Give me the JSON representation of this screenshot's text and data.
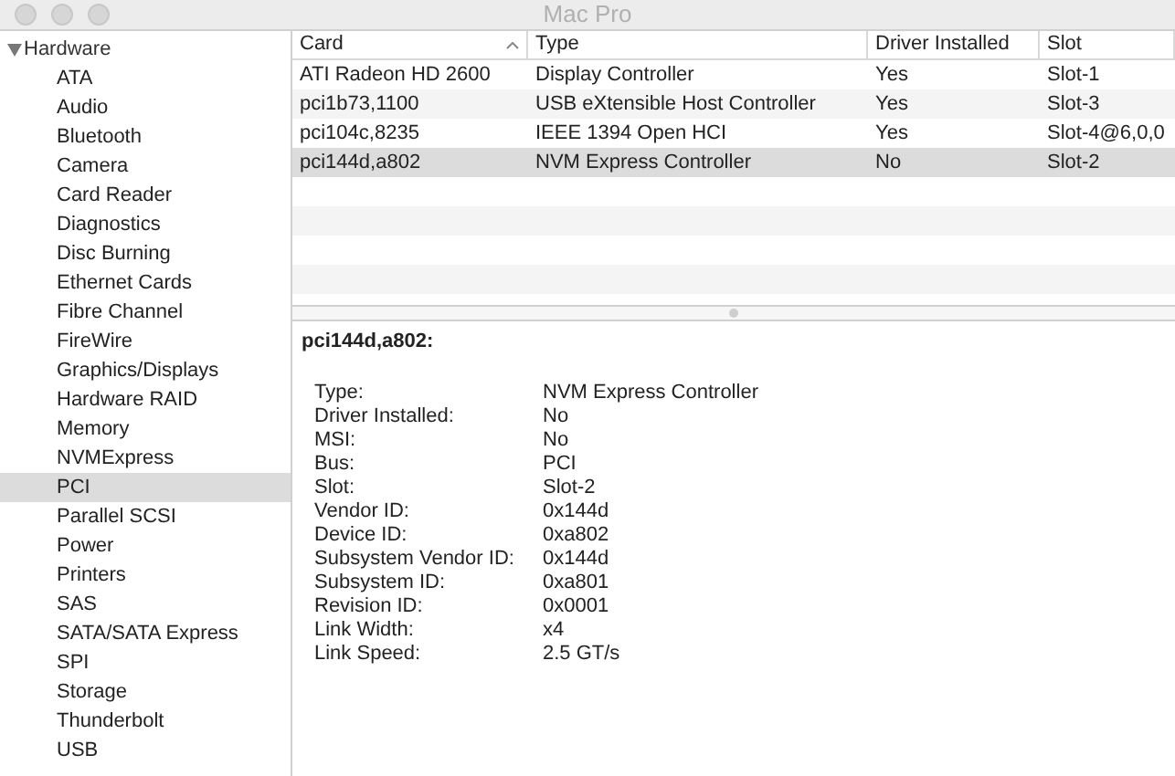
{
  "window": {
    "title": "Mac Pro"
  },
  "sidebar": {
    "group": {
      "label": "Hardware",
      "expanded": true,
      "children": [
        {
          "label": "ATA",
          "selected": false
        },
        {
          "label": "Audio",
          "selected": false
        },
        {
          "label": "Bluetooth",
          "selected": false
        },
        {
          "label": "Camera",
          "selected": false
        },
        {
          "label": "Card Reader",
          "selected": false
        },
        {
          "label": "Diagnostics",
          "selected": false
        },
        {
          "label": "Disc Burning",
          "selected": false
        },
        {
          "label": "Ethernet Cards",
          "selected": false
        },
        {
          "label": "Fibre Channel",
          "selected": false
        },
        {
          "label": "FireWire",
          "selected": false
        },
        {
          "label": "Graphics/Displays",
          "selected": false
        },
        {
          "label": "Hardware RAID",
          "selected": false
        },
        {
          "label": "Memory",
          "selected": false
        },
        {
          "label": "NVMExpress",
          "selected": false
        },
        {
          "label": "PCI",
          "selected": true
        },
        {
          "label": "Parallel SCSI",
          "selected": false
        },
        {
          "label": "Power",
          "selected": false
        },
        {
          "label": "Printers",
          "selected": false
        },
        {
          "label": "SAS",
          "selected": false
        },
        {
          "label": "SATA/SATA Express",
          "selected": false
        },
        {
          "label": "SPI",
          "selected": false
        },
        {
          "label": "Storage",
          "selected": false
        },
        {
          "label": "Thunderbolt",
          "selected": false
        },
        {
          "label": "USB",
          "selected": false
        }
      ]
    }
  },
  "table": {
    "columns": [
      {
        "label": "Card",
        "sorted": true
      },
      {
        "label": "Type",
        "sorted": false
      },
      {
        "label": "Driver Installed",
        "sorted": false
      },
      {
        "label": "Slot",
        "sorted": false
      }
    ],
    "rows": [
      {
        "cells": [
          "ATI Radeon HD 2600",
          "Display Controller",
          "Yes",
          "Slot-1"
        ],
        "selected": false
      },
      {
        "cells": [
          "pci1b73,1100",
          "USB eXtensible Host Controller",
          "Yes",
          "Slot-3"
        ],
        "selected": false
      },
      {
        "cells": [
          "pci104c,8235",
          "IEEE 1394 Open HCI",
          "Yes",
          "Slot-4@6,0,0"
        ],
        "selected": false
      },
      {
        "cells": [
          "pci144d,a802",
          "NVM Express Controller",
          "No",
          "Slot-2"
        ],
        "selected": true
      }
    ]
  },
  "details": {
    "title": "pci144d,a802:",
    "fields": [
      {
        "label": "Type:",
        "value": "NVM Express Controller"
      },
      {
        "label": "Driver Installed:",
        "value": "No"
      },
      {
        "label": "MSI:",
        "value": "No"
      },
      {
        "label": "Bus:",
        "value": "PCI"
      },
      {
        "label": "Slot:",
        "value": "Slot-2"
      },
      {
        "label": "Vendor ID:",
        "value": "0x144d"
      },
      {
        "label": "Device ID:",
        "value": "0xa802"
      },
      {
        "label": "Subsystem Vendor ID:",
        "value": "0x144d"
      },
      {
        "label": "Subsystem ID:",
        "value": "0xa801"
      },
      {
        "label": "Revision ID:",
        "value": "0x0001"
      },
      {
        "label": "Link Width:",
        "value": "x4"
      },
      {
        "label": "Link Speed:",
        "value": "2.5 GT/s"
      }
    ]
  }
}
